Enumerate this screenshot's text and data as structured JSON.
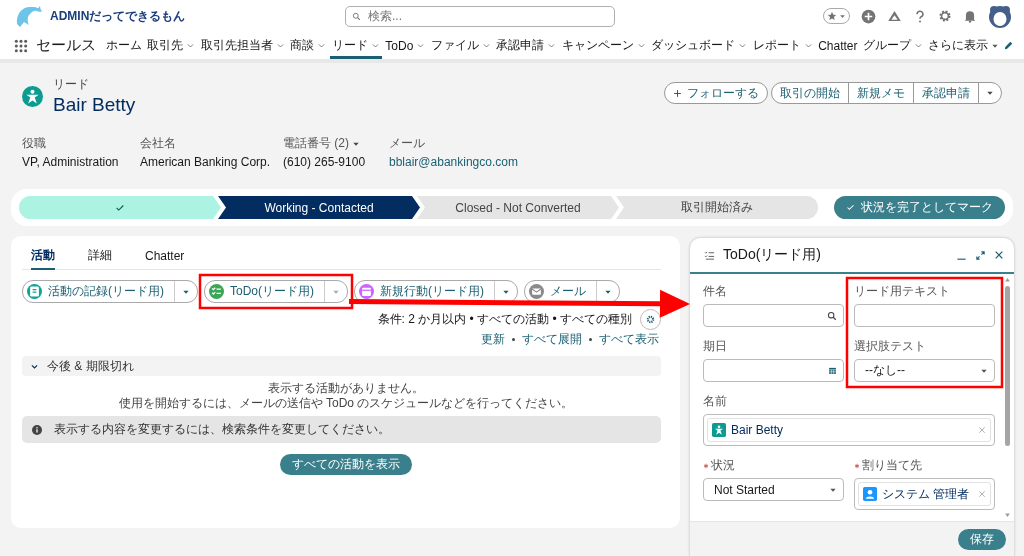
{
  "header": {
    "logo": "ADMINだってできるもん",
    "search": {
      "placeholder": "検索..."
    }
  },
  "nav": {
    "app": "セールス",
    "items": [
      {
        "label": "ホーム",
        "menu": false,
        "selected": false
      },
      {
        "label": "取引先",
        "menu": true,
        "selected": false
      },
      {
        "label": "取引先担当者",
        "menu": true,
        "selected": false
      },
      {
        "label": "商談",
        "menu": true,
        "selected": false
      },
      {
        "label": "リード",
        "menu": true,
        "selected": true
      },
      {
        "label": "ToDo",
        "menu": true,
        "selected": false
      },
      {
        "label": "ファイル",
        "menu": true,
        "selected": false
      },
      {
        "label": "承認申請",
        "menu": true,
        "selected": false
      },
      {
        "label": "キャンペーン",
        "menu": true,
        "selected": false
      },
      {
        "label": "ダッシュボード",
        "menu": true,
        "selected": false
      },
      {
        "label": "レポート",
        "menu": true,
        "selected": false
      },
      {
        "label": "Chatter",
        "menu": false,
        "selected": false
      },
      {
        "label": "グループ",
        "menu": true,
        "selected": false
      }
    ],
    "more": "さらに表示"
  },
  "record": {
    "type": "リード",
    "name": "Bair Betty",
    "actions": [
      {
        "label": "フォローする",
        "kind": "follow"
      },
      {
        "label": "取引の開始",
        "kind": "action"
      },
      {
        "label": "新規メモ",
        "kind": "action"
      },
      {
        "label": "承認申請",
        "kind": "action"
      }
    ],
    "fields": [
      {
        "label": "役職",
        "value": "VP, Administration",
        "link": false,
        "menu": false
      },
      {
        "label": "会社名",
        "value": "American Banking Corp.",
        "link": false,
        "menu": false
      },
      {
        "label": "電話番号 (2)",
        "value": "(610) 265-9100",
        "link": false,
        "menu": true
      },
      {
        "label": "メール",
        "value": "bblair@abankingco.com",
        "link": true,
        "menu": false
      }
    ]
  },
  "path": {
    "stages": [
      {
        "complete": true,
        "selected": false
      },
      {
        "label": "Working - Contacted",
        "complete": false,
        "selected": true
      },
      {
        "label": "Closed - Not Converted",
        "complete": false,
        "selected": false
      },
      {
        "label": "取引開始済み",
        "complete": false,
        "selected": false
      }
    ],
    "mark_button": "状況を完了としてマーク"
  },
  "activity": {
    "tabs": [
      {
        "label": "活動",
        "selected": true
      },
      {
        "label": "詳細",
        "selected": false
      },
      {
        "label": "Chatter",
        "selected": false
      }
    ],
    "composers": [
      {
        "label": "活動の記録(リード用)",
        "kind": "log"
      },
      {
        "label": "ToDo(リード用)",
        "kind": "task"
      },
      {
        "label": "新規行動(リード用)",
        "kind": "event"
      },
      {
        "label": "メール",
        "kind": "email"
      }
    ],
    "filter": "条件: 2 か月以内 • すべての活動 • すべての種別",
    "links": [
      "更新",
      "すべて展開",
      "すべて表示"
    ],
    "section": {
      "label": "今後 & 期限切れ",
      "expanded": true
    },
    "empty": [
      "表示する活動がありません。",
      "使用を開始するには、メールの送信や ToDo のスケジュールなどを行ってください。"
    ],
    "info": "表示する内容を変更するには、検索条件を変更してください。",
    "show_all": "すべての活動を表示"
  },
  "todo_panel": {
    "title": "ToDo(リード用)",
    "fields": [
      {
        "label": "件名",
        "kind": "search",
        "required": false,
        "wide": false
      },
      {
        "label": "リード用テキスト",
        "kind": "text",
        "required": false,
        "wide": false
      },
      {
        "label": "期日",
        "kind": "date",
        "required": false,
        "wide": false
      },
      {
        "label": "選択肢テスト",
        "kind": "select",
        "value": "--なし--",
        "required": false,
        "wide": false
      },
      {
        "label": "名前",
        "kind": "record",
        "value": "Bair Betty",
        "required": false,
        "wide": true
      },
      {
        "label": "状況",
        "kind": "select",
        "value": "Not Started",
        "required": true,
        "wide": false
      },
      {
        "label": "割り当て先",
        "kind": "user",
        "value": "システム 管理者",
        "required": true,
        "wide": false
      }
    ],
    "save": "保存"
  }
}
